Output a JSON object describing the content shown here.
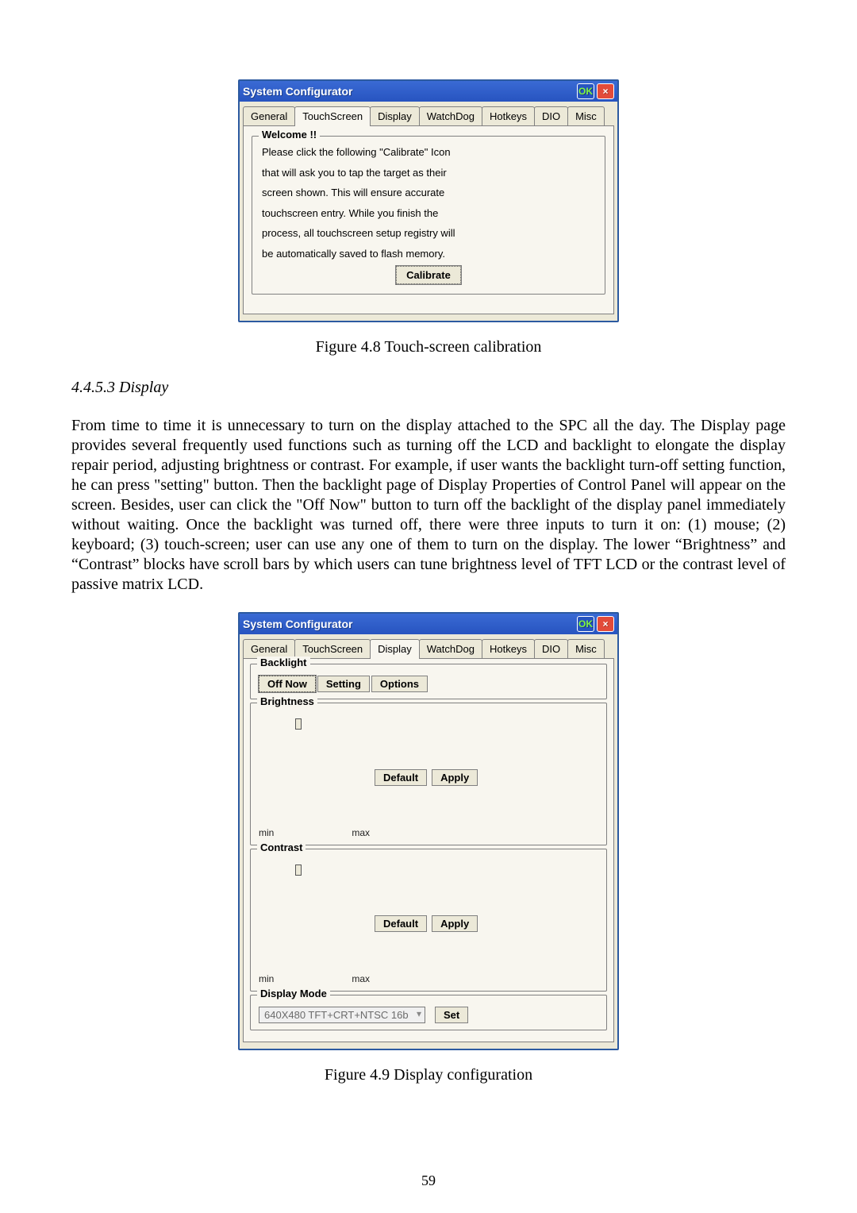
{
  "screenshot1": {
    "title": "System Configurator",
    "ok_label": "OK",
    "close_label": "×",
    "tabs": [
      "General",
      "TouchScreen",
      "Display",
      "WatchDog",
      "Hotkeys",
      "DIO",
      "Misc"
    ],
    "active_tab": "TouchScreen",
    "group_label": "Welcome !!",
    "instructions_line1": "Please click the following \"Calibrate\" Icon",
    "instructions_line2": "that will ask you to tap the target as their",
    "instructions_line3": "screen shown. This will ensure accurate",
    "instructions_line4": "touchscreen entry. While you finish the",
    "instructions_line5": "process, all touchscreen setup registry will",
    "instructions_line6": "be automatically saved to flash memory.",
    "calibrate_label": "Calibrate"
  },
  "caption1": "Figure 4.8 Touch-screen calibration",
  "subheading": "4.4.5.3 Display",
  "paragraph": "From time to time it is unnecessary to turn on the display attached to the SPC all the day. The Display page provides several frequently used functions such as turning off the LCD and backlight to elongate the display repair period, adjusting brightness or contrast. For example, if user wants the backlight turn-off setting function, he can press \"setting\" button. Then the backlight page of Display Properties of Control Panel will appear on the screen. Besides, user can click the \"Off Now\" button to turn off the backlight of the display panel immediately without waiting. Once the backlight was turned off, there were three inputs to turn it on: (1) mouse; (2) keyboard; (3) touch-screen; user can use any one of them to turn on the display. The lower “Brightness” and “Contrast” blocks have scroll bars by which users can tune brightness level of TFT LCD or the contrast level of passive matrix LCD.",
  "screenshot2": {
    "title": "System Configurator",
    "ok_label": "OK",
    "close_label": "×",
    "tabs": [
      "General",
      "TouchScreen",
      "Display",
      "WatchDog",
      "Hotkeys",
      "DIO",
      "Misc"
    ],
    "active_tab": "Display",
    "backlight": {
      "label": "Backlight",
      "off_now": "Off Now",
      "setting": "Setting",
      "options": "Options"
    },
    "brightness": {
      "label": "Brightness",
      "min": "min",
      "max": "max",
      "default": "Default",
      "apply": "Apply"
    },
    "contrast": {
      "label": "Contrast",
      "min": "min",
      "max": "max",
      "default": "Default",
      "apply": "Apply"
    },
    "display_mode": {
      "label": "Display Mode",
      "value": "640X480 TFT+CRT+NTSC 16b",
      "set": "Set"
    }
  },
  "caption2": "Figure 4.9 Display configuration",
  "page_number": "59"
}
